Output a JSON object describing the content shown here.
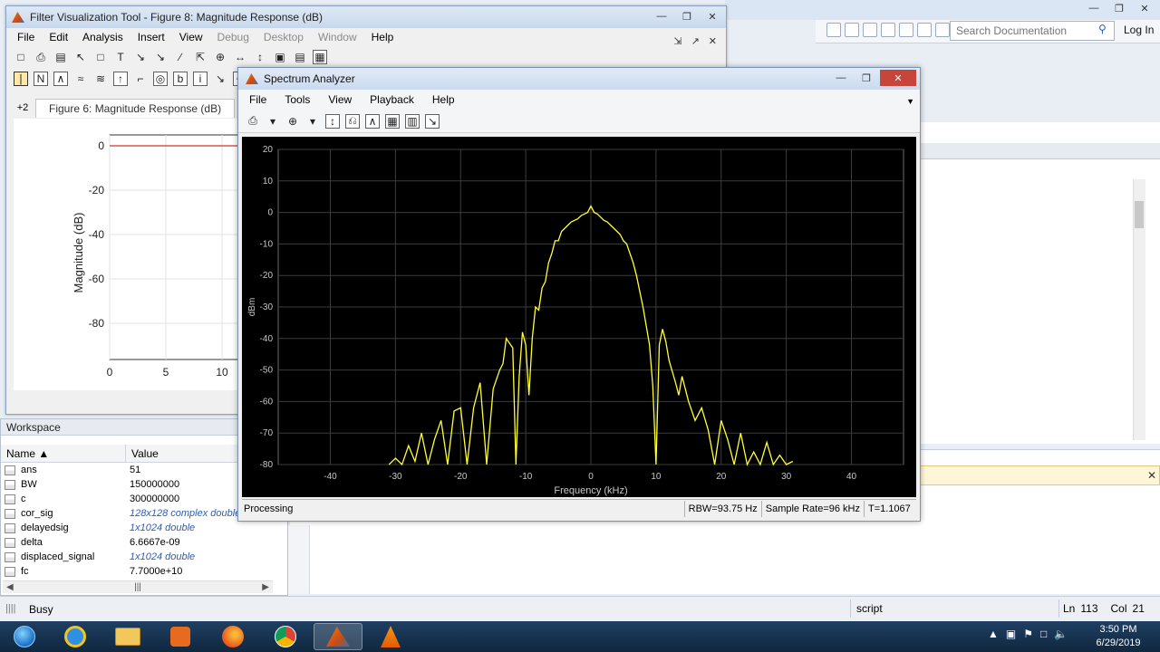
{
  "matlab": {
    "search_placeholder": "Search Documentation",
    "login_label": "Log In",
    "status": "Busy",
    "editor_mode": "script",
    "ln_label": "Ln",
    "ln_value": "113",
    "col_label": "Col",
    "col_value": "21"
  },
  "workspace": {
    "title": "Workspace",
    "col_name": "Name",
    "col_value": "Value",
    "rows": [
      {
        "name": "ans",
        "value": "51",
        "italic": false
      },
      {
        "name": "BW",
        "value": "150000000",
        "italic": false
      },
      {
        "name": "c",
        "value": "300000000",
        "italic": false
      },
      {
        "name": "cor_sig",
        "value": "128x128 complex double",
        "italic": true
      },
      {
        "name": "delayedsig",
        "value": "1x1024 double",
        "italic": true
      },
      {
        "name": "delta",
        "value": "6.6667e-09",
        "italic": false
      },
      {
        "name": "displaced_signal",
        "value": "1x1024 double",
        "italic": true
      },
      {
        "name": "fc",
        "value": "7.7000e+10",
        "italic": false
      }
    ]
  },
  "fvt": {
    "title": "Filter Visualization Tool - Figure 8: Magnitude Response (dB)",
    "menu": [
      {
        "label": "File",
        "enabled": true
      },
      {
        "label": "Edit",
        "enabled": true
      },
      {
        "label": "Analysis",
        "enabled": true
      },
      {
        "label": "Insert",
        "enabled": true
      },
      {
        "label": "View",
        "enabled": true
      },
      {
        "label": "Debug",
        "enabled": false
      },
      {
        "label": "Desktop",
        "enabled": false
      },
      {
        "label": "Window",
        "enabled": false
      },
      {
        "label": "Help",
        "enabled": true
      }
    ],
    "tab_more": "+2",
    "tab_label": "Figure 6: Magnitude Response (dB)",
    "ylabel": "Magnitude (dB)",
    "yticks": [
      "0",
      "-20",
      "-40",
      "-60",
      "-80"
    ],
    "xticks": [
      "0",
      "5",
      "10"
    ]
  },
  "spectrum": {
    "title": "Spectrum Analyzer",
    "menu": [
      "File",
      "Tools",
      "View",
      "Playback",
      "Help"
    ],
    "status_text": "Processing",
    "rbw": "RBW=93.75 Hz",
    "sample_rate": "Sample Rate=96 kHz",
    "time": "T=1.1067"
  },
  "clock": {
    "time": "3:50 PM",
    "date": "6/29/2019"
  },
  "colors": {
    "trace": "#ffff33",
    "plot_bg": "#000000",
    "grid": "#3c3c3c",
    "fvt_line": "#d9322a"
  },
  "chart_data": {
    "type": "line",
    "xlabel": "Frequency (kHz)",
    "ylabel": "dBm",
    "xlim": [
      -48,
      48
    ],
    "ylim": [
      -80,
      20
    ],
    "xticks": [
      -40,
      -30,
      -20,
      -10,
      0,
      10,
      20,
      30,
      40
    ],
    "yticks": [
      20,
      10,
      0,
      -10,
      -20,
      -30,
      -40,
      -50,
      -60,
      -70,
      -80
    ],
    "grid": true,
    "series": [
      {
        "x": [
          -31,
          -30,
          -29,
          -28,
          -27,
          -26,
          -25,
          -24,
          -23,
          -22,
          -21,
          -20,
          -19,
          -18,
          -17,
          -16,
          -15,
          -14,
          -13.5,
          -13,
          -12,
          -11.5,
          -11,
          -10.5,
          -10,
          -9.5,
          -9,
          -8.5,
          -8,
          -7.5,
          -7,
          -6.5,
          -6,
          -5.5,
          -5,
          -4.5,
          -4,
          -3.5,
          -3,
          -2.5,
          -2,
          -1.5,
          -1,
          -0.5,
          0,
          0.5,
          1,
          1.5,
          2,
          2.5,
          3,
          3.5,
          4,
          4.5,
          5,
          5.5,
          6,
          6.5,
          7,
          7.5,
          8,
          8.5,
          9,
          9.5,
          10,
          10.5,
          11,
          11.5,
          12,
          13,
          13.5,
          14,
          15,
          16,
          17,
          18,
          19,
          20,
          21,
          22,
          23,
          24,
          25,
          26,
          27,
          28,
          29,
          30,
          31
        ],
        "y": [
          -80,
          -78,
          -80,
          -74,
          -79,
          -70,
          -80,
          -72,
          -66,
          -80,
          -63,
          -62,
          -80,
          -62,
          -54,
          -80,
          -56,
          -50,
          -48,
          -40,
          -43,
          -80,
          -52,
          -38,
          -42,
          -58,
          -40,
          -30,
          -31,
          -24,
          -22,
          -16,
          -13,
          -9,
          -9,
          -6,
          -5,
          -4,
          -3,
          -2.5,
          -2,
          -1,
          -0.5,
          0,
          2,
          0,
          -0.5,
          -1.5,
          -2.5,
          -3,
          -4,
          -5,
          -6,
          -7,
          -9,
          -10,
          -13,
          -16,
          -20,
          -25,
          -30,
          -36,
          -42,
          -55,
          -80,
          -42,
          -37,
          -41,
          -47,
          -54,
          -58,
          -52,
          -60,
          -66,
          -62,
          -69,
          -80,
          -66,
          -72,
          -80,
          -70,
          -80,
          -76,
          -80,
          -73,
          -80,
          -77,
          -80,
          -79
        ]
      }
    ]
  }
}
